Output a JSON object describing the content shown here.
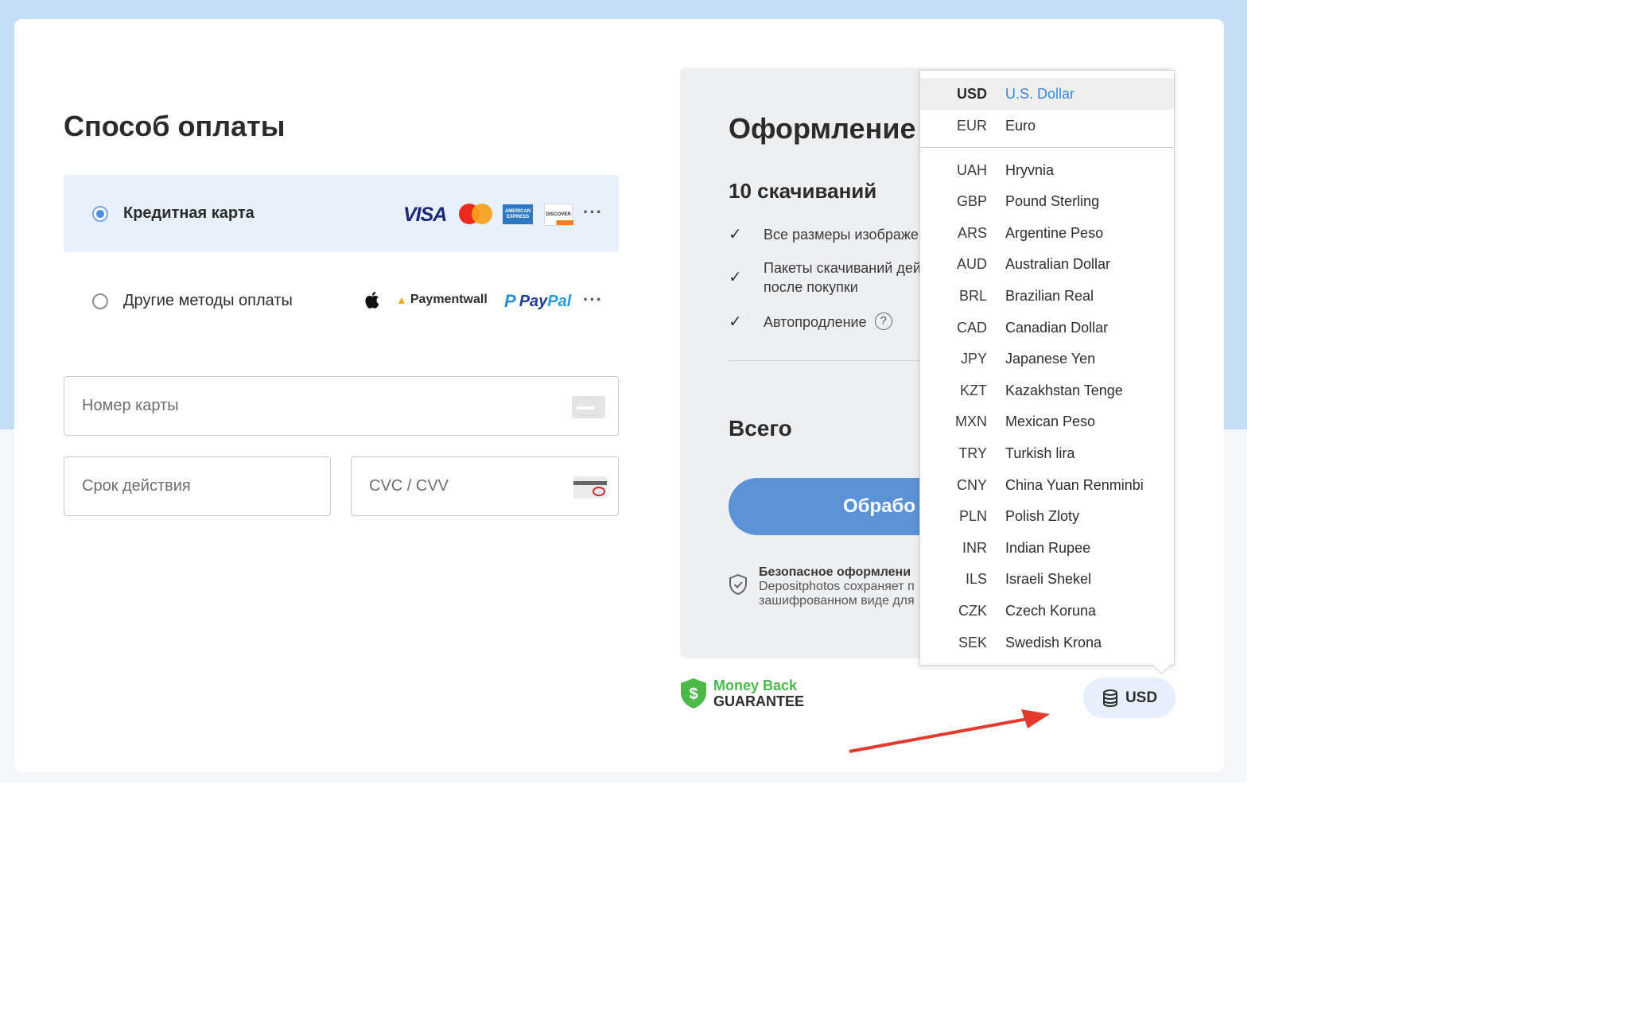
{
  "payment": {
    "title": "Способ оплаты",
    "options": [
      {
        "label": "Кредитная карта",
        "selected": true,
        "brands": [
          "visa-logo",
          "mastercard-logo",
          "amex-logo",
          "discover-logo"
        ]
      },
      {
        "label": "Другие методы оплаты",
        "selected": false,
        "brands": [
          "apple-logo",
          "paymentwall-logo",
          "paypal-logo"
        ]
      }
    ],
    "brand_text": {
      "visa": "VISA",
      "amex": "AMERICAN EXPRESS",
      "discover": "DISCOVER",
      "paymentwall": "Paymentwall",
      "paypal_pay": "Pay",
      "paypal_pal": "Pal",
      "more": "···"
    },
    "fields": {
      "card_number": {
        "placeholder": "Номер карты",
        "value": ""
      },
      "expiry": {
        "placeholder": "Срок действия",
        "value": ""
      },
      "cvc": {
        "placeholder": "CVC / CVV",
        "value": ""
      }
    }
  },
  "checkout": {
    "title": "Оформление",
    "package": "10 скачиваний",
    "features": [
      "Все размеры изображе",
      "Пакеты скачиваний дей",
      "после покупки",
      "Автопродление"
    ],
    "help_mark": "?",
    "total_label": "Всего",
    "process_button": "Обрабо",
    "secure_title": "Безопасное оформлени",
    "secure_line1": "Depositphotos сохраняет п",
    "secure_line2": "зашифрованном виде для"
  },
  "money_back": {
    "line1": "Money Back",
    "line2": "GUARANTEE",
    "symbol": "$"
  },
  "currency_button": {
    "label": "USD"
  },
  "currency_dropdown": {
    "selected": "USD",
    "items": [
      {
        "code": "USD",
        "name": "U.S. Dollar"
      },
      {
        "code": "EUR",
        "name": "Euro"
      },
      {
        "code": "UAH",
        "name": "Hryvnia"
      },
      {
        "code": "GBP",
        "name": "Pound Sterling"
      },
      {
        "code": "ARS",
        "name": "Argentine Peso"
      },
      {
        "code": "AUD",
        "name": "Australian Dollar"
      },
      {
        "code": "BRL",
        "name": "Brazilian Real"
      },
      {
        "code": "CAD",
        "name": "Canadian Dollar"
      },
      {
        "code": "JPY",
        "name": "Japanese Yen"
      },
      {
        "code": "KZT",
        "name": "Kazakhstan Tenge"
      },
      {
        "code": "MXN",
        "name": "Mexican Peso"
      },
      {
        "code": "TRY",
        "name": "Turkish lira"
      },
      {
        "code": "CNY",
        "name": "China Yuan Renminbi"
      },
      {
        "code": "PLN",
        "name": "Polish Zloty"
      },
      {
        "code": "INR",
        "name": "Indian Rupee"
      },
      {
        "code": "ILS",
        "name": "Israeli Shekel"
      },
      {
        "code": "CZK",
        "name": "Czech Koruna"
      },
      {
        "code": "SEK",
        "name": "Swedish Krona"
      }
    ]
  },
  "colors": {
    "accent": "#5b93d6",
    "selected_option_bg": "#e7f0fb",
    "dropdown_active_text": "#3b89d6",
    "money_back_green": "#4cb84a",
    "arrow_red": "#e23a2c"
  }
}
